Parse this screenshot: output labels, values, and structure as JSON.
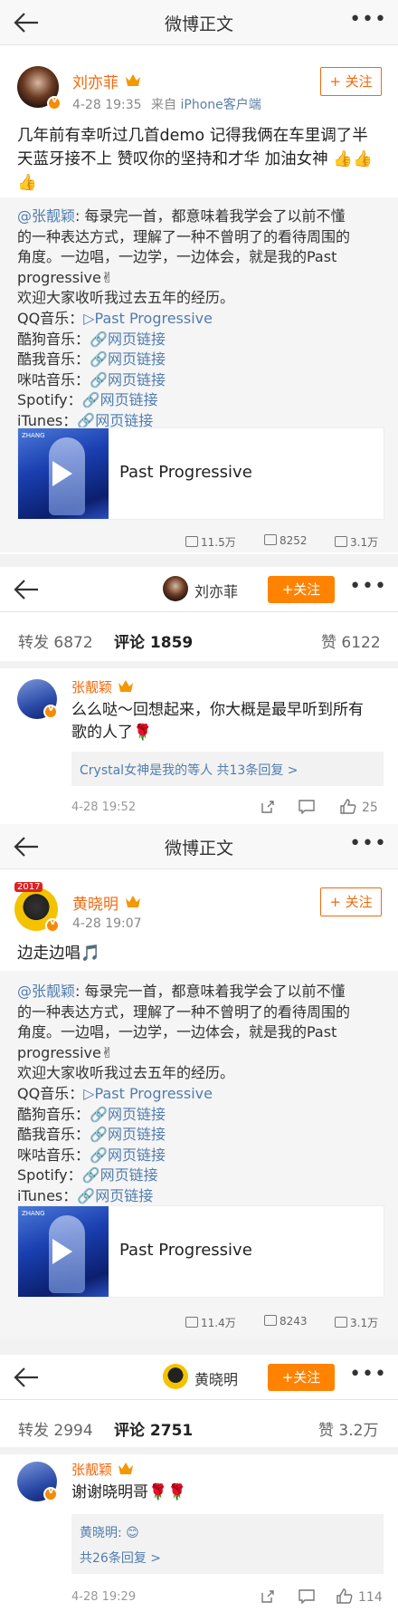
{
  "screen1": {
    "nav": {
      "title": "微博正文"
    },
    "post": {
      "user": "刘亦菲",
      "time": "4-28 19:35",
      "source_prefix": "来自",
      "source": "iPhone客户端",
      "follow": "+ 关注",
      "text_lines": [
        "几年前有幸听过几首demo 记得我俩在车里调了半",
        "天蓝牙接不上 赞叹你的坚持和才华 加油女神 👍👍",
        "👍"
      ]
    },
    "repost": {
      "lines": [
        {
          "mention": "@张靓颖",
          "text": ": 每录完一首，都意味着我学会了以前不懂"
        },
        {
          "text": "的一种表达方式，理解了一种不曾明了的看待周围的"
        },
        {
          "text": "角度。一边唱，一边学，一边体会，就是我的Past"
        },
        {
          "text": "progressive✌"
        },
        {
          "text": "欢迎大家收听我过去五年的经历。"
        },
        {
          "label": "QQ音乐：",
          "link": "▷Past Progressive"
        },
        {
          "label": "酷狗音乐：",
          "link": "🔗网页链接"
        },
        {
          "label": "酷我音乐：",
          "link": "🔗网页链接"
        },
        {
          "label": "咪咕音乐：",
          "link": "🔗网页链接"
        },
        {
          "label": "Spotify：",
          "link": "🔗网页链接"
        },
        {
          "label": "iTunes：",
          "link": "🔗网页链接"
        }
      ],
      "card_title": "Past Progressive",
      "card_tag": "ZHANG",
      "stats": {
        "repost": "11.5万",
        "comment": "8252",
        "like": "3.1万"
      }
    }
  },
  "screen2": {
    "nav_user": "刘亦菲",
    "follow": "+关注",
    "tabs": {
      "repost": "转发 6872",
      "comment": "评论 1859",
      "like": "赞 6122"
    },
    "comment": {
      "user": "张靓颖",
      "text_lines": [
        "么么哒～回想起来，你大概是最早听到所有",
        "歌的人了🌹"
      ],
      "reply_summary": "Crystal女神是我的等人 共13条回复 >",
      "time": "4-28 19:52",
      "likes": "25"
    }
  },
  "screen3": {
    "nav": {
      "title": "微博正文"
    },
    "post": {
      "user": "黄晓明",
      "time": "4-28 19:07",
      "follow": "+ 关注",
      "text": "边走边唱🎵",
      "avatar_badge": "2017"
    },
    "repost": {
      "lines": [
        {
          "mention": "@张靓颖",
          "text": ": 每录完一首，都意味着我学会了以前不懂"
        },
        {
          "text": "的一种表达方式，理解了一种不曾明了的看待周围的"
        },
        {
          "text": "角度。一边唱，一边学，一边体会，就是我的Past"
        },
        {
          "text": "progressive✌"
        },
        {
          "text": "欢迎大家收听我过去五年的经历。"
        },
        {
          "label": "QQ音乐：",
          "link": "▷Past Progressive"
        },
        {
          "label": "酷狗音乐：",
          "link": "🔗网页链接"
        },
        {
          "label": "酷我音乐：",
          "link": "🔗网页链接"
        },
        {
          "label": "咪咕音乐：",
          "link": "🔗网页链接"
        },
        {
          "label": "Spotify：",
          "link": "🔗网页链接"
        },
        {
          "label": "iTunes：",
          "link": "🔗网页链接"
        }
      ],
      "card_title": "Past Progressive",
      "card_tag": "ZHANG",
      "stats": {
        "repost": "11.4万",
        "comment": "8243",
        "like": "3.1万"
      }
    }
  },
  "screen4": {
    "nav_user": "黄晓明",
    "follow": "+关注",
    "tabs": {
      "repost": "转发 2994",
      "comment": "评论 2751",
      "like": "赞 3.2万"
    },
    "comment": {
      "user": "张靓颖",
      "text": "谢谢晓明哥🌹🌹",
      "reply_first": "黄晓明: 😊",
      "reply_count": "共26条回复 >",
      "time": "4-28 19:29",
      "likes": "114"
    }
  },
  "colors": {
    "accent": "#ff8200",
    "name": "#f06a0f",
    "link": "#507daf"
  },
  "icons": [
    "back-arrow-icon",
    "more-dots-icon",
    "crown-icon",
    "verified-badge-icon",
    "play-icon",
    "share-icon",
    "comment-icon",
    "like-icon"
  ]
}
